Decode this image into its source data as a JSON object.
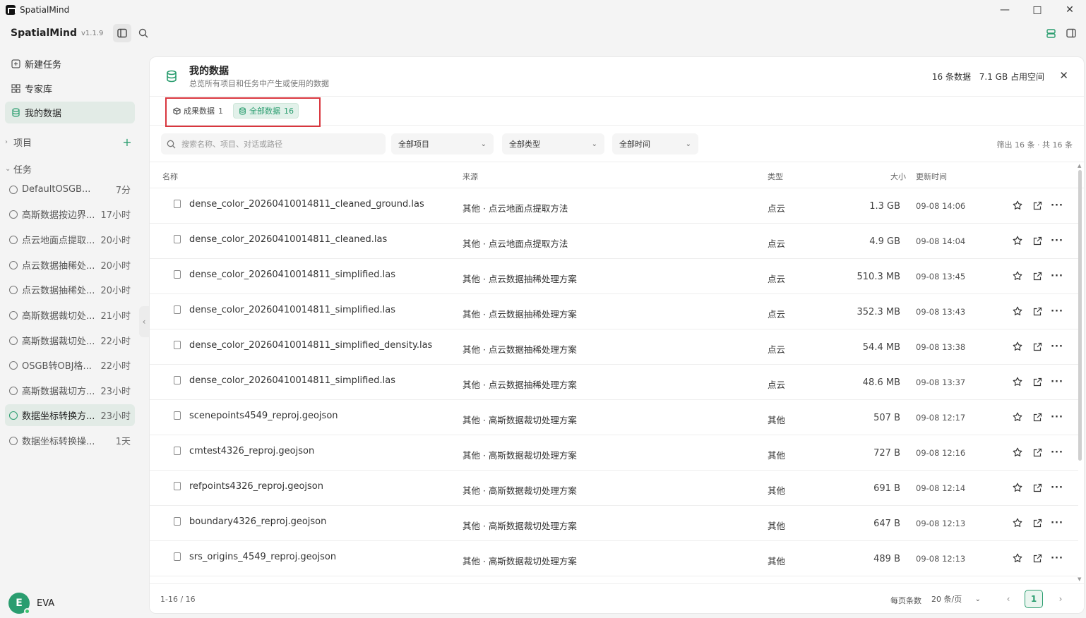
{
  "window": {
    "title": "SpatialMind"
  },
  "app": {
    "name": "SpatialMind",
    "version": "v1.1.9"
  },
  "nav": [
    {
      "label": "新建任务",
      "icon": "new-task-icon"
    },
    {
      "label": "专家库",
      "icon": "grid-icon"
    },
    {
      "label": "我的数据",
      "icon": "database-icon",
      "active": true
    }
  ],
  "sections": {
    "projects": "项目",
    "tasks": "任务"
  },
  "tasks": [
    {
      "name": "DefaultOSGB...",
      "time": "7分"
    },
    {
      "name": "高斯数据按边界...",
      "time": "17小时"
    },
    {
      "name": "点云地面点提取...",
      "time": "20小时"
    },
    {
      "name": "点云数据抽稀处...",
      "time": "20小时"
    },
    {
      "name": "点云数据抽稀处...",
      "time": "20小时"
    },
    {
      "name": "高斯数据裁切处...",
      "time": "21小时"
    },
    {
      "name": "高斯数据裁切处...",
      "time": "22小时"
    },
    {
      "name": "OSGB转OBJ格...",
      "time": "22小时"
    },
    {
      "name": "高斯数据裁切方...",
      "time": "23小时"
    },
    {
      "name": "数据坐标转换方...",
      "time": "23小时",
      "active": true
    },
    {
      "name": "数据坐标转换操...",
      "time": "1天"
    }
  ],
  "user": {
    "initial": "E",
    "name": "EVA"
  },
  "panel": {
    "title": "我的数据",
    "subtitle": "总览所有项目和任务中产生或使用的数据",
    "count_stat": "16 条数据",
    "space_stat": "7.1 GB 占用空间",
    "tabs": [
      {
        "label": "成果数据",
        "count": "1"
      },
      {
        "label": "全部数据",
        "count": "16",
        "active": true
      }
    ],
    "search_placeholder": "搜索名称、项目、对话或路径",
    "filters": {
      "project": "全部项目",
      "type": "全部类型",
      "time": "全部时间"
    },
    "filter_count": "筛出 16 条 · 共 16 条",
    "columns": {
      "name": "名称",
      "source": "来源",
      "type": "类型",
      "size": "大小",
      "updated": "更新时间"
    },
    "rows": [
      {
        "name": "dense_color_20260410014811_cleaned_ground.las",
        "source": "其他 · 点云地面点提取方法",
        "type": "点云",
        "size": "1.3 GB",
        "time": "09-08 14:06"
      },
      {
        "name": "dense_color_20260410014811_cleaned.las",
        "source": "其他 · 点云地面点提取方法",
        "type": "点云",
        "size": "4.9 GB",
        "time": "09-08 14:04"
      },
      {
        "name": "dense_color_20260410014811_simplified.las",
        "source": "其他 · 点云数据抽稀处理方案",
        "type": "点云",
        "size": "510.3 MB",
        "time": "09-08 13:45"
      },
      {
        "name": "dense_color_20260410014811_simplified.las",
        "source": "其他 · 点云数据抽稀处理方案",
        "type": "点云",
        "size": "352.3 MB",
        "time": "09-08 13:43"
      },
      {
        "name": "dense_color_20260410014811_simplified_density.las",
        "source": "其他 · 点云数据抽稀处理方案",
        "type": "点云",
        "size": "54.4 MB",
        "time": "09-08 13:38"
      },
      {
        "name": "dense_color_20260410014811_simplified.las",
        "source": "其他 · 点云数据抽稀处理方案",
        "type": "点云",
        "size": "48.6 MB",
        "time": "09-08 13:37"
      },
      {
        "name": "scenepoints4549_reproj.geojson",
        "source": "其他 · 高斯数据裁切处理方案",
        "type": "其他",
        "size": "507 B",
        "time": "09-08 12:17"
      },
      {
        "name": "cmtest4326_reproj.geojson",
        "source": "其他 · 高斯数据裁切处理方案",
        "type": "其他",
        "size": "727 B",
        "time": "09-08 12:16"
      },
      {
        "name": "refpoints4326_reproj.geojson",
        "source": "其他 · 高斯数据裁切处理方案",
        "type": "其他",
        "size": "691 B",
        "time": "09-08 12:14"
      },
      {
        "name": "boundary4326_reproj.geojson",
        "source": "其他 · 高斯数据裁切处理方案",
        "type": "其他",
        "size": "647 B",
        "time": "09-08 12:13"
      },
      {
        "name": "srs_origins_4549_reproj.geojson",
        "source": "其他 · 高斯数据裁切处理方案",
        "type": "其他",
        "size": "489 B",
        "time": "09-08 12:13"
      }
    ],
    "footer": {
      "range": "1-16 / 16",
      "per_page_label": "每页条数",
      "per_page": "20 条/页",
      "current_page": "1"
    }
  },
  "colors": {
    "accent": "#2a9d6f",
    "highlight": "#d9363e"
  }
}
